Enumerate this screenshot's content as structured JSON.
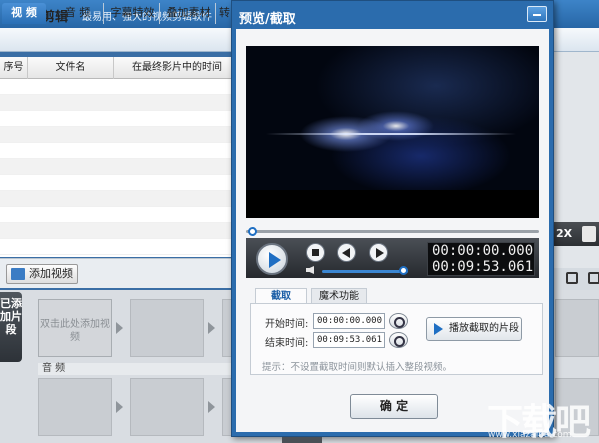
{
  "app": {
    "name": "爱剪辑",
    "slogan": "最易用、强大的视频剪辑软件"
  },
  "tabs": [
    {
      "label": "视 频"
    },
    {
      "label": "音 频"
    },
    {
      "label": "字幕特效"
    },
    {
      "label": "叠加素材"
    },
    {
      "label": "转"
    }
  ],
  "file_list": {
    "columns": [
      "序号",
      "文件名",
      "在最终影片中的时间"
    ]
  },
  "add_video_label": "添加视频",
  "speed_label": "2X",
  "clip_panel": {
    "side_label": "已添加片段",
    "placeholder": "双击此处添加视频",
    "audio_label": "音 频"
  },
  "dialog": {
    "title": "预览/截取",
    "current_time": "00:00:00.000",
    "total_time": "00:09:53.061",
    "progress": 0.0,
    "volume": 0.92,
    "tabs": [
      {
        "label": "截取"
      },
      {
        "label": "魔术功能"
      }
    ],
    "start_label": "开始时间:",
    "start_value": "00:00:00.000",
    "end_label": "结束时间:",
    "end_value": "00:09:53.061",
    "play_clip_label": "播放截取的片段",
    "hint": "提示：不设置截取时间则默认插入整段视频。",
    "ok_label": "确 定"
  },
  "watermark": {
    "text": "下载吧",
    "sub": "www.xiazaiba.com"
  },
  "colors": {
    "accent": "#2b6cad",
    "tab_active": "#2a6fb5",
    "control_bar": "#2c2f33"
  }
}
